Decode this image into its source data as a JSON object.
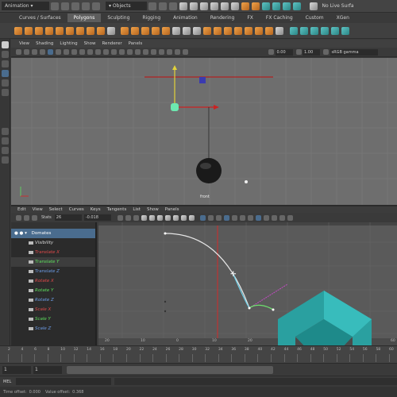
{
  "topbar": {
    "mode": "Animation",
    "objects": "Objects",
    "live_surface": "No Live Surfa"
  },
  "shelf_tabs": [
    "Curves / Surfaces",
    "Polygons",
    "Sculpting",
    "Rigging",
    "Animation",
    "Rendering",
    "FX",
    "FX Caching",
    "Custom",
    "XGen"
  ],
  "active_shelf": "Polygons",
  "viewport": {
    "menus": [
      "View",
      "Shading",
      "Lighting",
      "Show",
      "Renderer",
      "Panels"
    ],
    "field1": "0.00",
    "field2": "1.00",
    "color_space": "sRGB gamma",
    "camera_label": "front"
  },
  "graph_editor": {
    "menus": [
      "Edit",
      "View",
      "Select",
      "Curves",
      "Keys",
      "Tangents",
      "List",
      "Show",
      "Panels"
    ],
    "stats_label": "Stats",
    "stats_frame": "26",
    "stats_value": "-0.018",
    "object_name": "Domates",
    "channels": [
      {
        "name": "Visibility",
        "color": "#d8d8d8"
      },
      {
        "name": "Translate X",
        "color": "#e04a4a"
      },
      {
        "name": "Translate Y",
        "color": "#5ee05e"
      },
      {
        "name": "Translate Z",
        "color": "#6d9de8"
      },
      {
        "name": "Rotate X",
        "color": "#e04a4a"
      },
      {
        "name": "Rotate Y",
        "color": "#5ee05e"
      },
      {
        "name": "Rotate Z",
        "color": "#6d9de8"
      },
      {
        "name": "Scale X",
        "color": "#e04a4a"
      },
      {
        "name": "Scale Y",
        "color": "#5ee05e"
      },
      {
        "name": "Scale Z",
        "color": "#6d9de8"
      }
    ],
    "ruler": [
      "20",
      "10",
      "0",
      "10",
      "20",
      "30",
      "40",
      "50",
      "60"
    ]
  },
  "timeline": {
    "ticks": [
      "2",
      "4",
      "6",
      "8",
      "10",
      "12",
      "14",
      "16",
      "18",
      "20",
      "22",
      "24",
      "26",
      "28",
      "30",
      "32",
      "34",
      "36",
      "38",
      "40",
      "42",
      "44",
      "46",
      "48",
      "50",
      "52",
      "54",
      "56",
      "58",
      "60"
    ],
    "start_field": "1",
    "current_field": "1"
  },
  "status": {
    "mel_label": "MEL",
    "bottom_left": "Time offset:",
    "time_offset": "0.000",
    "value_offset_label": "Value offset:",
    "value_offset": "0.368"
  },
  "colors": {
    "accent": "#4a6c8e",
    "curve": "#e6e6e6",
    "time_marker": "#d02a2a",
    "logo": "#2aa0a0"
  }
}
